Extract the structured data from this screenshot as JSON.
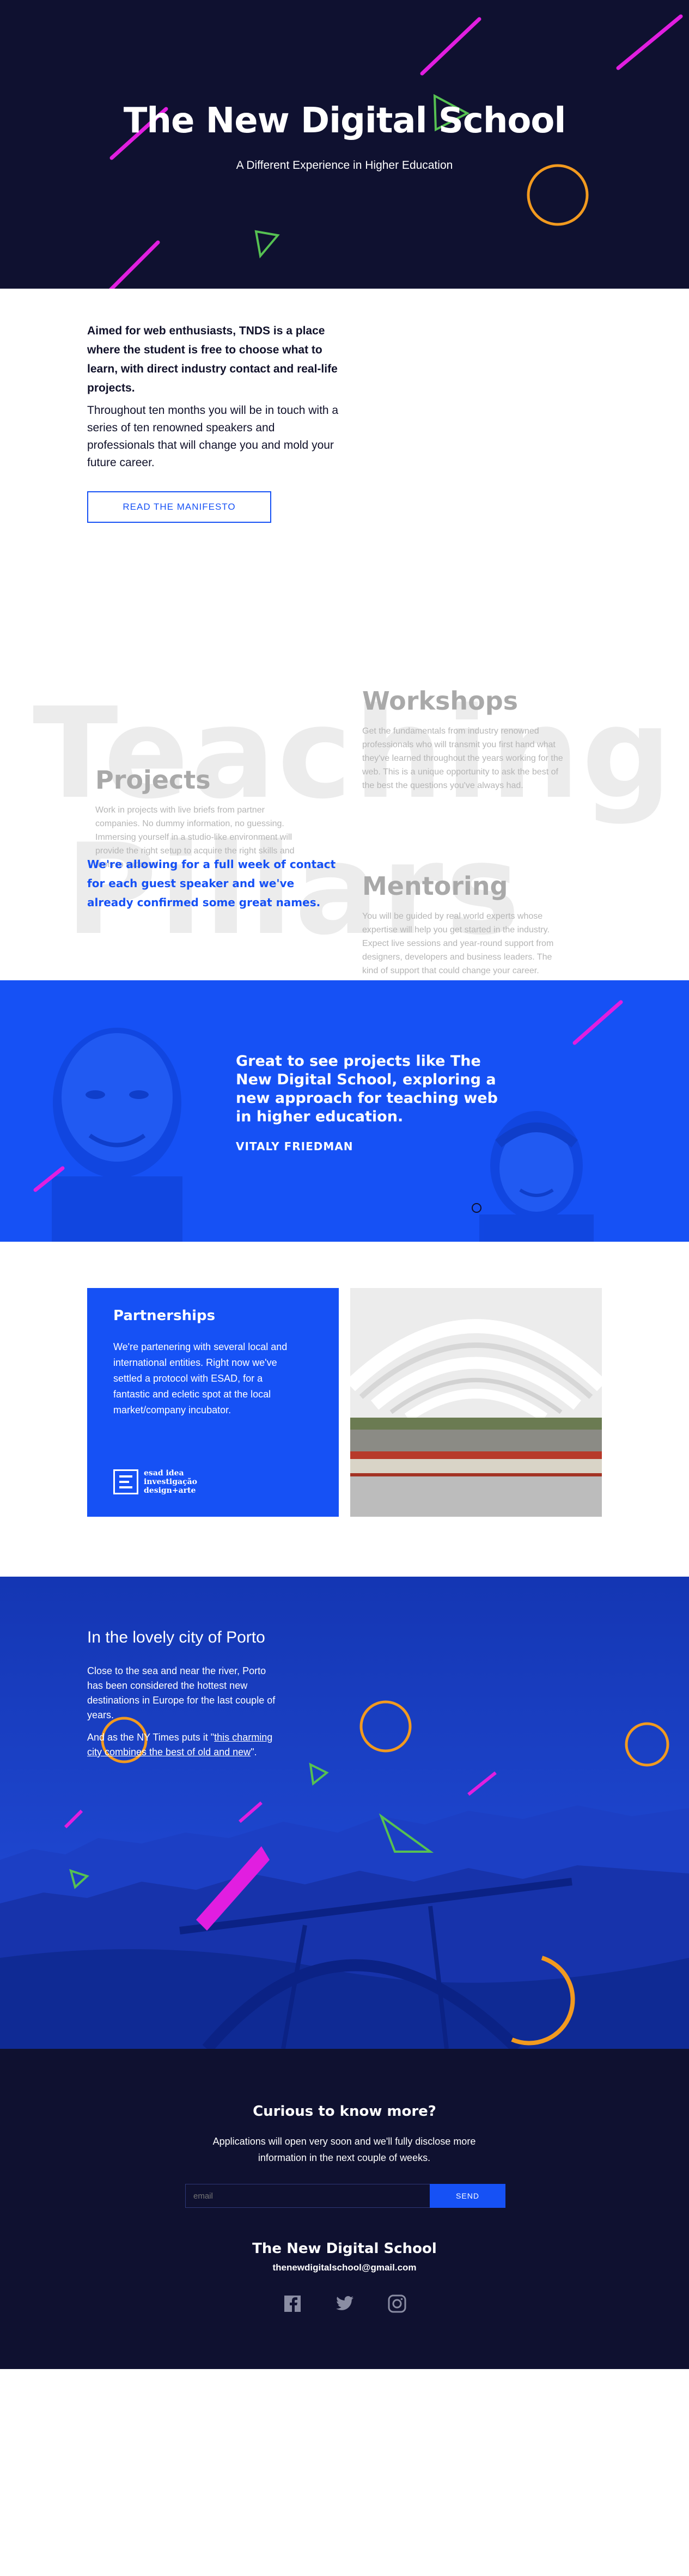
{
  "hero": {
    "title": "The New Digital School",
    "subtitle": "A Different Experience in Higher Education"
  },
  "intro": {
    "lead": "Aimed for web enthusiasts, TNDS is a place where the student is free to choose what to learn, with direct industry contact and real-life projects.",
    "body": "Throughout ten months you will be in touch with a series of ten renowned speakers and professionals that will change you and mold your future career.",
    "button_label": "READ THE MANIFESTO"
  },
  "pillars": {
    "big_word_1": "Teaching",
    "big_word_2": "Pillars",
    "items": [
      {
        "title": "Workshops",
        "text": "Get the fundamentals from industry renowned professionals who will transmit you first hand what they've learned throughout the years working for the web. This is a unique opportunity to ask the best of the best the questions you've always had."
      },
      {
        "title": "Projects",
        "text": "Work in projects with live briefs from partner companies. No dummy information, no guessing. Immersing yourself in a studio-like environment will provide the right setup to acquire the right skills and tools to succeed."
      },
      {
        "title": "Mentoring",
        "text": "You will be guided by real world experts whose expertise will help you get started in the industry. Expect live sessions and year-round support from designers, developers and business leaders. The kind of support that could change your career."
      }
    ]
  },
  "allow_text": "We're allowing for a full week of contact for each guest speaker and we've already confirmed some great names.",
  "quote": {
    "text": "Great to see projects like The New Digital School, exploring a new approach for teaching web in higher education.",
    "author": "VITALY FRIEDMAN"
  },
  "partners": {
    "title": "Partnerships",
    "text": "We're partenering with several local and international entities. Right now we've settled a protocol with ESAD, for a fantastic and ecletic spot at the local market/company incubator.",
    "logo_text": [
      "esad idea",
      "investigação",
      "design+arte"
    ]
  },
  "porto": {
    "title": "In the lovely city of Porto",
    "text1": "Close to the sea and near the river, Porto has been considered the hottest new destinations in Europe for the last couple of years.",
    "text2_prefix": "And as the NY Times puts it \"",
    "text2_link": "this charming city combines the best of old and new",
    "text2_suffix": "\"."
  },
  "footer": {
    "title": "Curious to know more?",
    "text": "Applications will open very soon and we'll fully disclose more information in the next couple of weeks.",
    "email_placeholder": "email",
    "send_label": "SEND",
    "brand": "The New Digital School",
    "email": "thenewdigitalschool@gmail.com",
    "social": [
      "facebook-icon",
      "twitter-icon",
      "instagram-icon"
    ]
  },
  "colors": {
    "navy": "#0f1130",
    "blue": "#1651f5",
    "magenta": "#e11ee0",
    "green": "#56c152",
    "orange": "#f29a1f"
  }
}
